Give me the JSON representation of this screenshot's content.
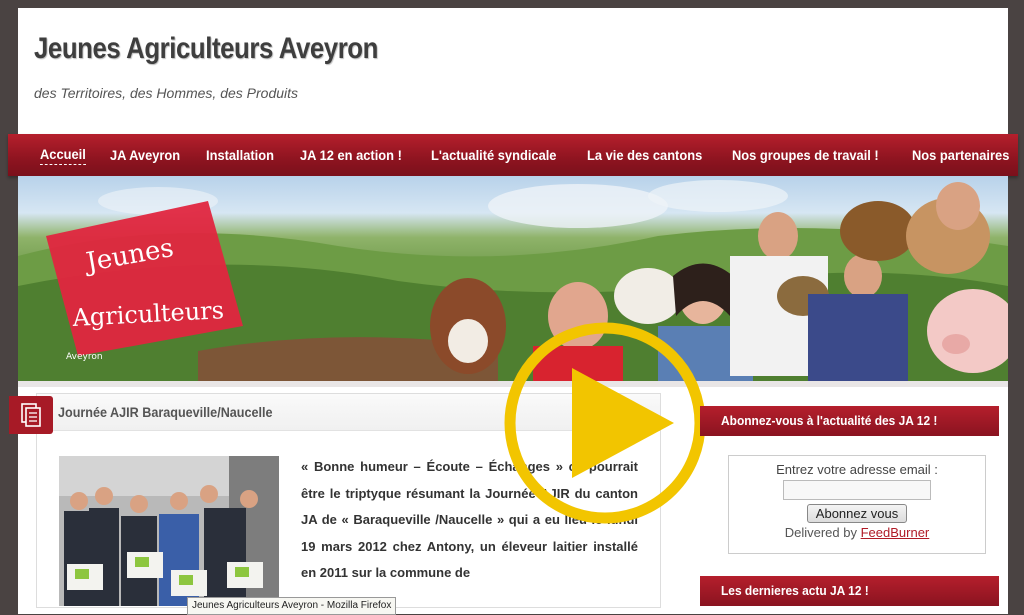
{
  "header": {
    "title": "Jeunes Agriculteurs Aveyron",
    "tagline": "des Territoires, des Hommes, des Produits"
  },
  "nav": {
    "items": [
      {
        "label": "Accueil",
        "active": true
      },
      {
        "label": "JA Aveyron"
      },
      {
        "label": "Installation"
      },
      {
        "label": "JA 12 en action !"
      },
      {
        "label": "L'actualité syndicale"
      },
      {
        "label": "La vie des cantons"
      },
      {
        "label": "Nos groupes de travail !"
      },
      {
        "label": "Nos partenaires"
      }
    ]
  },
  "banner": {
    "logo_line1": "Jeunes",
    "logo_line2": "Agriculteurs",
    "logo_line3": "Aveyron"
  },
  "post": {
    "title": "Journée AJIR Baraqueville/Naucelle",
    "body": "« Bonne humeur – Écoute – Échanges » ce pourrait être le triptyque résumant la Journée AJIR du canton JA de « Baraqueville /Naucelle » qui a eu lieu le lundi 19 mars 2012 chez Antony, un éleveur laitier installé en 2011 sur la commune de"
  },
  "tooltip": "Jeunes Agriculteurs Aveyron - Mozilla Firefox",
  "sidebar": {
    "subscribe_title": "Abonnez-vous à l'actualité des JA 12 !",
    "email_label": "Entrez votre adresse email :",
    "email_value": "",
    "subscribe_button": "Abonnez vous",
    "delivered_by": "Delivered by",
    "feedburner": "FeedBurner",
    "news_title": "Les dernieres actu JA 12 !"
  },
  "colors": {
    "brand_red": "#a71a26",
    "play_yellow": "#f2c500",
    "background": "#4a4342"
  }
}
